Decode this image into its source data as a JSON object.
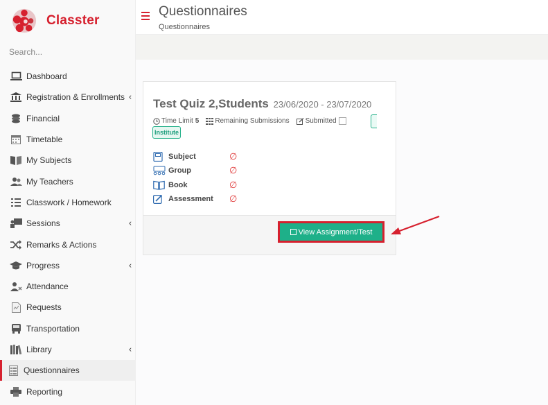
{
  "app": {
    "name": "Classter"
  },
  "sidebar": {
    "search_placeholder": "Search...",
    "items": [
      {
        "label": "Dashboard",
        "icon": "laptop-icon",
        "has_submenu": false
      },
      {
        "label": "Registration & Enrollments",
        "icon": "institution-icon",
        "has_submenu": true
      },
      {
        "label": "Financial",
        "icon": "coins-icon",
        "has_submenu": false
      },
      {
        "label": "Timetable",
        "icon": "calendar-icon",
        "has_submenu": false
      },
      {
        "label": "My Subjects",
        "icon": "open-book-icon",
        "has_submenu": false
      },
      {
        "label": "My Teachers",
        "icon": "users-icon",
        "has_submenu": false
      },
      {
        "label": "Classwork / Homework",
        "icon": "checklist-icon",
        "has_submenu": false
      },
      {
        "label": "Sessions",
        "icon": "presentation-icon",
        "has_submenu": true
      },
      {
        "label": "Remarks & Actions",
        "icon": "shuffle-icon",
        "has_submenu": false
      },
      {
        "label": "Progress",
        "icon": "graduation-cap-icon",
        "has_submenu": true
      },
      {
        "label": "Attendance",
        "icon": "user-x-icon",
        "has_submenu": false
      },
      {
        "label": "Requests",
        "icon": "document-icon",
        "has_submenu": false
      },
      {
        "label": "Transportation",
        "icon": "bus-icon",
        "has_submenu": false
      },
      {
        "label": "Library",
        "icon": "books-icon",
        "has_submenu": true
      },
      {
        "label": "Questionnaires",
        "icon": "list-icon",
        "has_submenu": false,
        "active": true
      },
      {
        "label": "Reporting",
        "icon": "printer-icon",
        "has_submenu": false
      }
    ]
  },
  "header": {
    "title": "Questionnaires",
    "breadcrumb": "Questionnaires"
  },
  "quiz": {
    "title": "Test Quiz 2,Students",
    "dates": "23/06/2020 - 23/07/2020",
    "time_limit_label": "Time Limit",
    "time_limit_value": "5",
    "remaining_label": "Remaining Submissions",
    "submitted_label": "Submitted",
    "badge": "Institute",
    "rows": [
      {
        "label": "Subject",
        "icon": "subject-book-icon",
        "value": "∅"
      },
      {
        "label": "Group",
        "icon": "group-icon",
        "value": "∅"
      },
      {
        "label": "Book",
        "icon": "book-icon",
        "value": "∅"
      },
      {
        "label": "Assessment",
        "icon": "edit-icon",
        "value": "∅"
      }
    ],
    "button_label": "View Assignment/Test"
  },
  "colors": {
    "brand": "#d6202e",
    "accent_green": "#1eb089",
    "empty_value": "#e03b3b"
  }
}
